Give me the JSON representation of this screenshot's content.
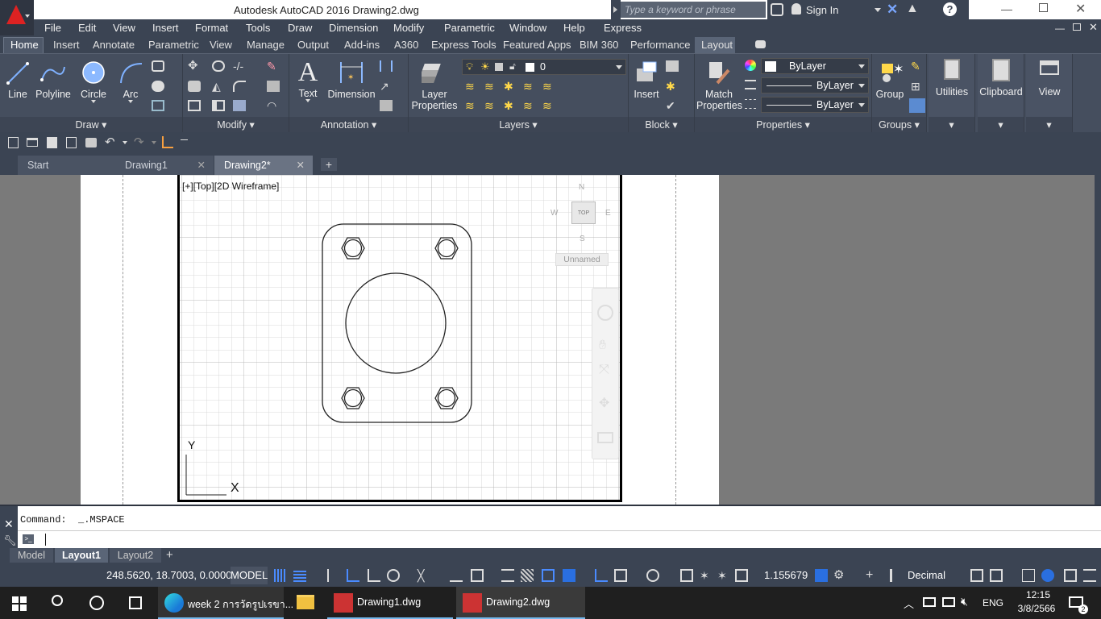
{
  "title": {
    "text": "Autodesk AutoCAD 2016    Drawing2.dwg",
    "search_placeholder": "Type a keyword or phrase",
    "signin": "Sign In"
  },
  "menu": [
    "File",
    "Edit",
    "View",
    "Insert",
    "Format",
    "Tools",
    "Draw",
    "Dimension",
    "Modify",
    "Parametric",
    "Window",
    "Help",
    "Express"
  ],
  "ribbon_tabs": [
    "Home",
    "Insert",
    "Annotate",
    "Parametric",
    "View",
    "Manage",
    "Output",
    "Add-ins",
    "A360",
    "Express Tools",
    "Featured Apps",
    "BIM 360",
    "Performance",
    "Layout"
  ],
  "draw": {
    "line": "Line",
    "polyline": "Polyline",
    "circle": "Circle",
    "arc": "Arc",
    "footer": "Draw"
  },
  "modify": {
    "footer": "Modify"
  },
  "annotation": {
    "text": "Text",
    "dimension": "Dimension",
    "footer": "Annotation"
  },
  "layers": {
    "layer_properties_line1": "Layer",
    "layer_properties_line2": "Properties",
    "current_layer": "0",
    "footer": "Layers"
  },
  "block": {
    "insert": "Insert",
    "footer": "Block"
  },
  "properties": {
    "match_line1": "Match",
    "match_line2": "Properties",
    "color": "ByLayer",
    "linetype": "ByLayer",
    "lineweight": "ByLayer",
    "footer": "Properties"
  },
  "groups": {
    "group": "Group",
    "footer": "Groups"
  },
  "utilities": "Utilities",
  "clipboard": "Clipboard",
  "view_panel": "View",
  "doc_tabs": [
    "Start",
    "Drawing1",
    "Drawing2*"
  ],
  "viewport_label": "[+][Top][2D Wireframe]",
  "viewcube": {
    "n": "N",
    "s": "S",
    "e": "E",
    "w": "W",
    "top": "TOP",
    "ucs": "Unnamed"
  },
  "ucs_axes": {
    "x": "X",
    "y": "Y"
  },
  "command": {
    "history": "Command:  _.MSPACE",
    "input": ""
  },
  "layout_tabs": [
    "Model",
    "Layout1",
    "Layout2"
  ],
  "status": {
    "coords": "248.5620, 18.7003, 0.0000",
    "model": "MODEL",
    "scale": "1.155679",
    "units": "Decimal"
  },
  "taskbar": {
    "edge_task": "week 2 การวัดรูปเรขา...",
    "drawing1": "Drawing1.dwg",
    "drawing2": "Drawing2.dwg",
    "lang": "ENG",
    "time": "12:15",
    "date": "3/8/2566",
    "notif": "2"
  }
}
